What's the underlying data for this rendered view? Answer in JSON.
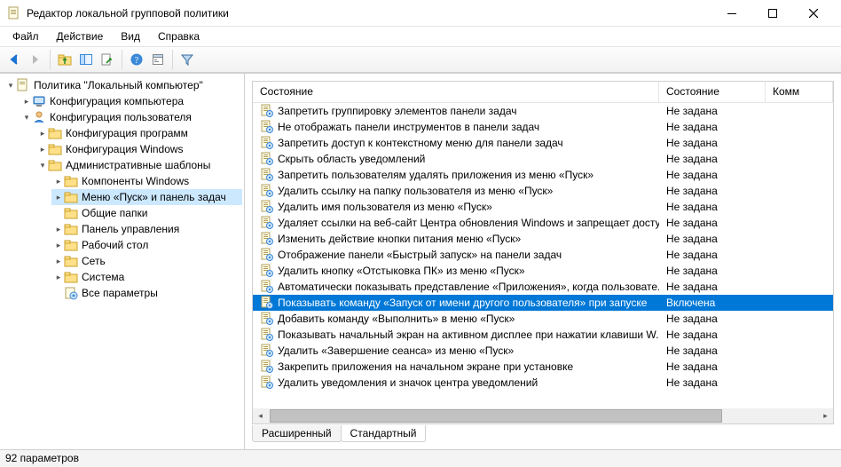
{
  "window": {
    "title": "Редактор локальной групповой политики"
  },
  "menu": {
    "file": "Файл",
    "action": "Действие",
    "view": "Вид",
    "help": "Справка"
  },
  "tree": {
    "root": "Политика \"Локальный компьютер\"",
    "computer_config": "Конфигурация компьютера",
    "user_config": "Конфигурация пользователя",
    "software_settings": "Конфигурация программ",
    "windows_settings": "Конфигурация Windows",
    "admin_templates": "Административные шаблоны",
    "windows_components": "Компоненты Windows",
    "start_taskbar": "Меню «Пуск» и панель задач",
    "shared_folders": "Общие папки",
    "control_panel": "Панель управления",
    "desktop": "Рабочий стол",
    "network": "Сеть",
    "system": "Система",
    "all_settings": "Все параметры"
  },
  "columns": {
    "name": "Состояние",
    "state": "Состояние",
    "comment": "Комм"
  },
  "state_not_set": "Не задана",
  "state_enabled": "Включена",
  "settings": [
    {
      "name": "Запретить группировку элементов панели задач",
      "state": "Не задана"
    },
    {
      "name": "Не отображать панели инструментов в панели задач",
      "state": "Не задана"
    },
    {
      "name": "Запретить доступ к контекстному меню для панели задач",
      "state": "Не задана"
    },
    {
      "name": "Скрыть область уведомлений",
      "state": "Не задана"
    },
    {
      "name": "Запретить пользователям удалять приложения из меню «Пуск»",
      "state": "Не задана"
    },
    {
      "name": "Удалить ссылку на папку пользователя из меню «Пуск»",
      "state": "Не задана"
    },
    {
      "name": "Удалить имя пользователя из меню «Пуск»",
      "state": "Не задана"
    },
    {
      "name": "Удаляет ссылки на веб-сайт Центра обновления Windows и запрещает досту...",
      "state": "Не задана"
    },
    {
      "name": "Изменить действие кнопки питания меню «Пуск»",
      "state": "Не задана"
    },
    {
      "name": "Отображение панели «Быстрый запуск» на панели задач",
      "state": "Не задана"
    },
    {
      "name": "Удалить кнопку «Отстыковка ПК» из меню «Пуск»",
      "state": "Не задана"
    },
    {
      "name": "Автоматически показывать представление «Приложения», когда пользовате...",
      "state": "Не задана"
    },
    {
      "name": "Показывать команду «Запуск от имени другого пользователя» при запуске",
      "state": "Включена",
      "selected": true
    },
    {
      "name": "Добавить команду «Выполнить» в меню «Пуск»",
      "state": "Не задана"
    },
    {
      "name": "Показывать начальный экран на активном дисплее при нажатии клавиши W...",
      "state": "Не задана"
    },
    {
      "name": "Удалить «Завершение сеанса» из меню «Пуск»",
      "state": "Не задана"
    },
    {
      "name": "Закрепить приложения на начальном экране при установке",
      "state": "Не задана"
    },
    {
      "name": "Удалить уведомления и значок центра уведомлений",
      "state": "Не задана"
    }
  ],
  "tabs": {
    "extended": "Расширенный",
    "standard": "Стандартный"
  },
  "status": "92 параметров"
}
